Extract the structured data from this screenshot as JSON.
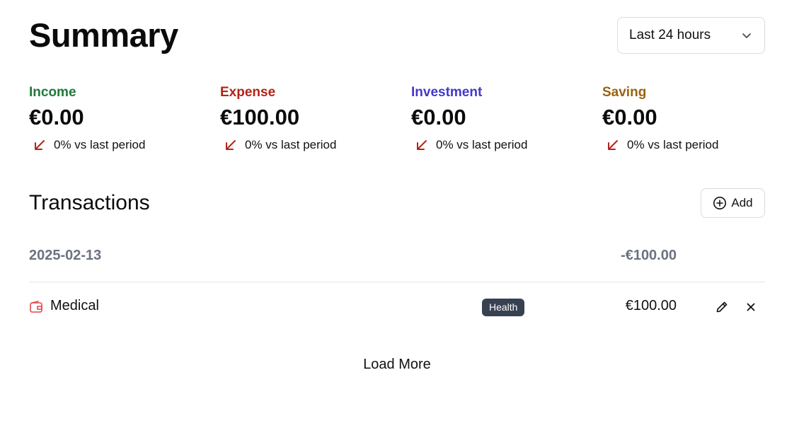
{
  "header": {
    "title": "Summary",
    "period_select": {
      "value": "Last 24 hours"
    }
  },
  "stats": [
    {
      "label": "Income",
      "amount": "€0.00",
      "trend": "0% vs last period",
      "color": "#1f7a3a"
    },
    {
      "label": "Expense",
      "amount": "€100.00",
      "trend": "0% vs last period",
      "color": "#b42318"
    },
    {
      "label": "Investment",
      "amount": "€0.00",
      "trend": "0% vs last period",
      "color": "#4338ca"
    },
    {
      "label": "Saving",
      "amount": "€0.00",
      "trend": "0% vs last period",
      "color": "#9a6212"
    }
  ],
  "transactions": {
    "title": "Transactions",
    "add_label": "Add",
    "groups": [
      {
        "date": "2025-02-13",
        "total": "-€100.00",
        "items": [
          {
            "name": "Medical",
            "tag": "Health",
            "amount": "€100.00",
            "icon": "wallet-icon"
          }
        ]
      }
    ],
    "load_more_label": "Load More"
  },
  "colors": {
    "trend_down": "#b42318",
    "tag_bg": "#374151",
    "muted": "#6b7280",
    "expense_icon": "#e04848"
  }
}
